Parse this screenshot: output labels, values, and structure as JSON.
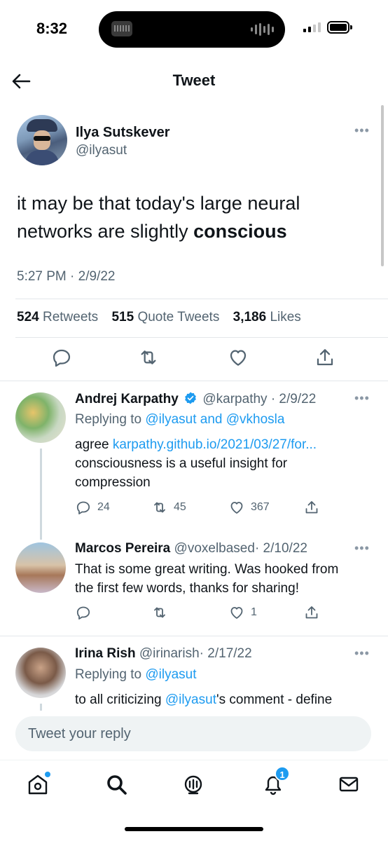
{
  "status_bar": {
    "time": "8:32"
  },
  "header": {
    "title": "Tweet"
  },
  "main_tweet": {
    "name": "Ilya Sutskever",
    "handle": "@ilyasut",
    "text_plain": "it may be that today's large neural networks are slightly ",
    "text_bold": "conscious",
    "timestamp": "5:27 PM · 2/9/22",
    "retweets_count": "524",
    "retweets_label": "Retweets",
    "quotes_count": "515",
    "quotes_label": "Quote Tweets",
    "likes_count": "3,186",
    "likes_label": "Likes"
  },
  "replies": [
    {
      "name": "Andrej Karpathy",
      "verified": true,
      "handle": "@karpathy",
      "date": "· 2/9/22",
      "replying_prefix": "Replying to",
      "replying_to": "@ilyasut and @vkhosla",
      "line1_text": "agree",
      "line1_link": "karpathy.github.io/2021/03/27/for...",
      "line2": "consciousness is a useful insight for",
      "line3": "compression",
      "reply_count": "24",
      "retweet_count": "45",
      "like_count": "367"
    },
    {
      "name": "Marcos Pereira",
      "handle": "@voxelbased",
      "date": "· 2/10/22",
      "line1": "That is some great writing. Was hooked from",
      "line2": "the first few words, thanks for sharing!",
      "reply_count": "",
      "retweet_count": "",
      "like_count": "1"
    },
    {
      "name": "Irina Rish",
      "handle": "@irinarish",
      "date": "· 2/17/22",
      "replying_prefix": "Replying to",
      "replying_to": "@ilyasut",
      "line1_text": "to all criticizing",
      "line1_link": "@ilyasut",
      "line1_suffix": "'s comment - define"
    }
  ],
  "reply_box": {
    "placeholder": "Tweet your reply"
  },
  "tabbar": {
    "notifications_badge": "1"
  },
  "colors": {
    "accent": "#1d9bf0",
    "muted": "#536471",
    "text": "#0f1419"
  }
}
